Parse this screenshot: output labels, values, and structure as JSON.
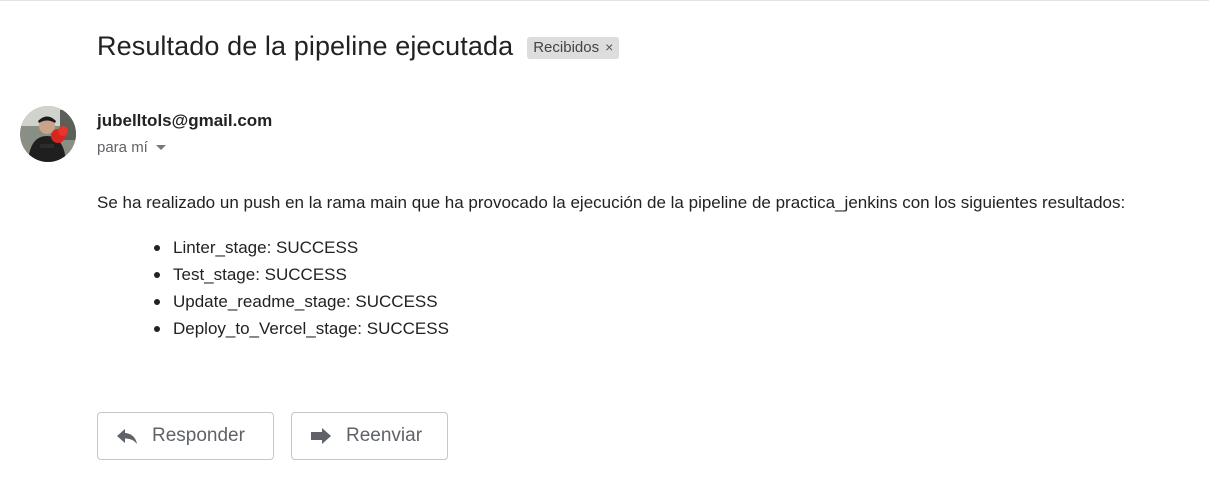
{
  "email": {
    "subject": "Resultado de la pipeline ejecutada",
    "label": "Recibidos",
    "label_close": "×",
    "sender": "jubelltols@gmail.com",
    "recipient": "para mí",
    "body": "Se ha realizado un push en la rama main que ha provocado la ejecución de la pipeline de practica_jenkins con los siguientes resultados:",
    "results": [
      "Linter_stage: SUCCESS",
      "Test_stage: SUCCESS",
      "Update_readme_stage: SUCCESS",
      "Deploy_to_Vercel_stage: SUCCESS"
    ]
  },
  "actions": {
    "reply_label": "Responder",
    "forward_label": "Reenviar",
    "reply_icon": "reply-arrow-icon",
    "forward_icon": "forward-arrow-icon"
  },
  "colors": {
    "label_chip_bg": "#dddddd",
    "button_border": "#c6c6c6",
    "button_text": "#5f6368"
  }
}
